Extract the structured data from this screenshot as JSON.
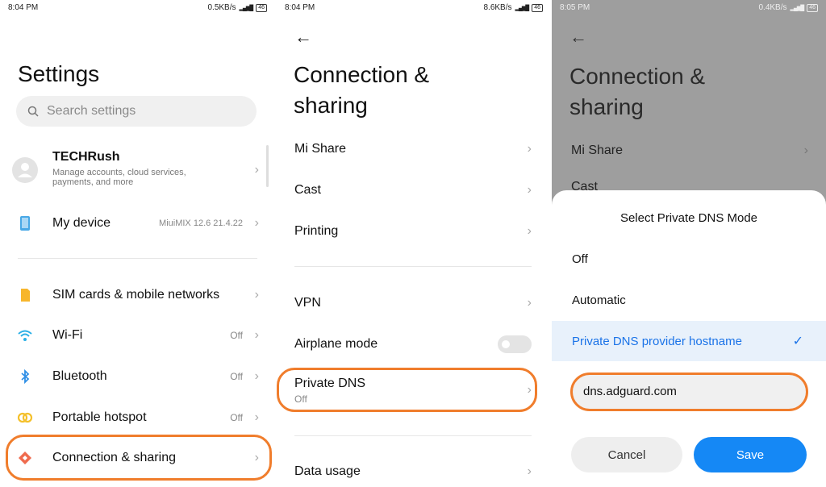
{
  "panels": [
    {
      "status": {
        "time": "8:04 PM",
        "speed": "0.5KB/s",
        "battery": "46"
      },
      "title": "Settings",
      "search": {
        "placeholder": "Search settings"
      },
      "account": {
        "name": "TECHRush",
        "subtitle_line1": "Manage accounts, cloud services,",
        "subtitle_line2": "payments, and more"
      },
      "device": {
        "label": "My device",
        "value": "MiuiMIX 12.6  21.4.22"
      },
      "items": [
        {
          "label": "SIM cards & mobile networks",
          "value": "",
          "icon": "sim-card-icon"
        },
        {
          "label": "Wi-Fi",
          "value": "Off",
          "icon": "wifi-icon"
        },
        {
          "label": "Bluetooth",
          "value": "Off",
          "icon": "bluetooth-icon"
        },
        {
          "label": "Portable hotspot",
          "value": "Off",
          "icon": "hotspot-icon"
        },
        {
          "label": "Connection & sharing",
          "value": "",
          "icon": "connection-sharing-icon"
        }
      ]
    },
    {
      "status": {
        "time": "8:04 PM",
        "speed": "8.6KB/s",
        "battery": "46"
      },
      "title_line1": "Connection &",
      "title_line2": "sharing",
      "items": [
        {
          "label": "Mi Share"
        },
        {
          "label": "Cast"
        },
        {
          "label": "Printing"
        },
        {
          "label": "VPN"
        },
        {
          "label": "Airplane mode",
          "toggle": "off"
        },
        {
          "label": "Private DNS",
          "sub": "Off"
        },
        {
          "label": "Data usage"
        }
      ]
    },
    {
      "status": {
        "time": "8:05 PM",
        "speed": "0.4KB/s",
        "battery": "46"
      },
      "title_line1": "Connection &",
      "title_line2": "sharing",
      "items": [
        {
          "label": "Mi Share"
        },
        {
          "label": "Cast"
        }
      ],
      "dialog": {
        "title": "Select Private DNS Mode",
        "options": [
          "Off",
          "Automatic",
          "Private DNS provider hostname"
        ],
        "selected": "Private DNS provider hostname",
        "hostname_value": "dns.adguard.com",
        "cancel_label": "Cancel",
        "save_label": "Save"
      }
    }
  ],
  "colors": {
    "highlight": "#f07d2c",
    "accent": "#1a73e8",
    "save_button": "#1588f5"
  }
}
